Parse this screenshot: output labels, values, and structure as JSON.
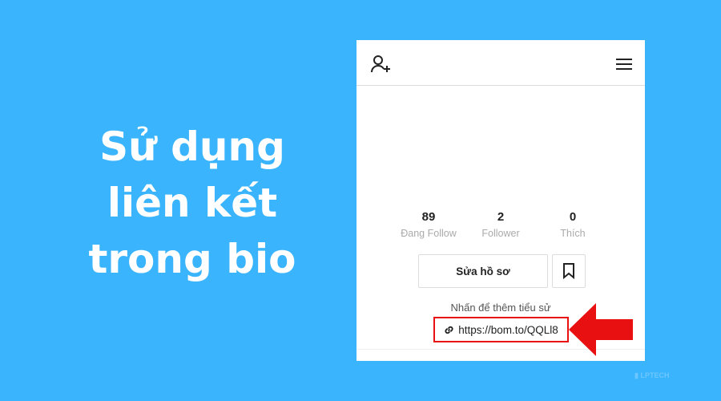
{
  "headline": {
    "line1": "Sử dụng",
    "line2": "liên kết",
    "line3": "trong bio"
  },
  "profile": {
    "stats": [
      {
        "value": "89",
        "label": "Đang Follow"
      },
      {
        "value": "2",
        "label": "Follower"
      },
      {
        "value": "0",
        "label": "Thích"
      }
    ],
    "edit_label": "Sửa hồ sơ",
    "bio_placeholder": "Nhấn để thêm tiểu sử",
    "link": "https://bom.to/QQLl8"
  },
  "logo": {
    "text": "LPTECH"
  },
  "colors": {
    "background": "#3ab4fc",
    "highlight": "#e81010"
  }
}
